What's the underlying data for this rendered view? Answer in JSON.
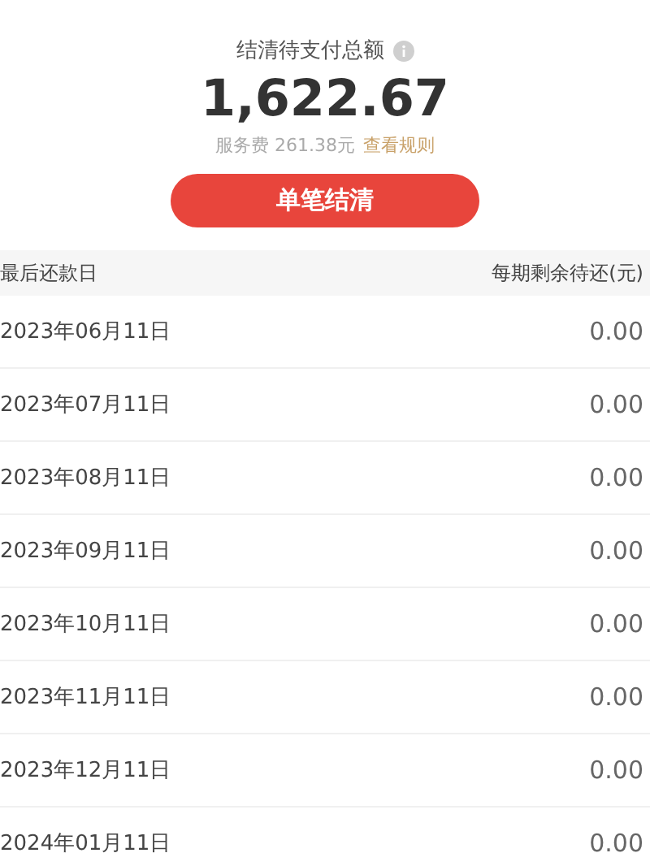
{
  "summary": {
    "label": "结清待支付总额",
    "amount": "1,622.67",
    "fee": "服务费 261.38元",
    "rule_link": "查看规则"
  },
  "settle_button": "单笔结清",
  "table": {
    "columns": [
      "最后还款日",
      "每期剩余待还(元)"
    ],
    "rows": [
      {
        "date": "2023年06月11日",
        "amount": "0.00"
      },
      {
        "date": "2023年07月11日",
        "amount": "0.00"
      },
      {
        "date": "2023年08月11日",
        "amount": "0.00"
      },
      {
        "date": "2023年09月11日",
        "amount": "0.00"
      },
      {
        "date": "2023年10月11日",
        "amount": "0.00"
      },
      {
        "date": "2023年11月11日",
        "amount": "0.00"
      },
      {
        "date": "2023年12月11日",
        "amount": "0.00"
      },
      {
        "date": "2024年01月11日",
        "amount": "0.00"
      }
    ]
  }
}
